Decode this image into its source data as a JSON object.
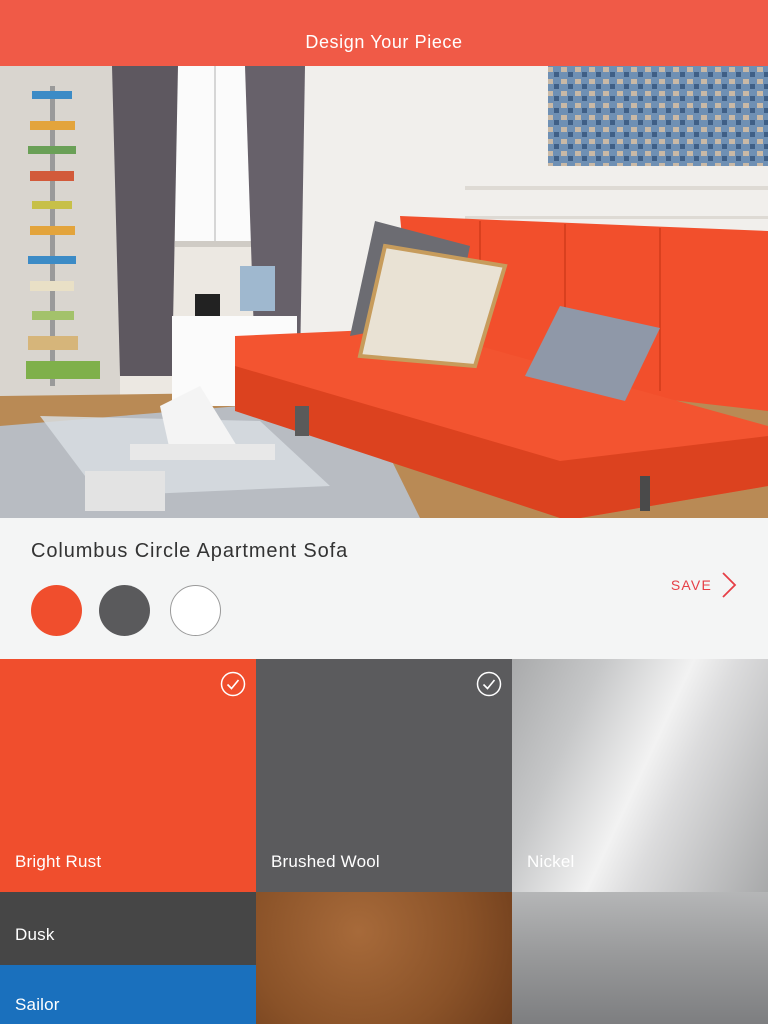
{
  "header": {
    "title": "Design Your Piece"
  },
  "product": {
    "name": "Columbus Circle Apartment Sofa",
    "swatches": [
      {
        "name": "Bright Rust",
        "color": "#f04e2d"
      },
      {
        "name": "Brushed Wool",
        "color": "#5a5a5c"
      },
      {
        "name": "White",
        "color": "#ffffff"
      }
    ],
    "save_label": "SAVE"
  },
  "materials": [
    {
      "label": "Bright Rust",
      "selected": true,
      "color": "#f04e2d"
    },
    {
      "label": "Brushed Wool",
      "selected": true,
      "color": "#5b5b5d"
    },
    {
      "label": "Nickel",
      "selected": false,
      "color": "#c6c7c8"
    },
    {
      "label": "Dusk",
      "selected": false,
      "color": "#464646"
    },
    {
      "label": "",
      "selected": false,
      "color": "#8a5228"
    },
    {
      "label": "",
      "selected": false,
      "color": "#9a9b9c"
    },
    {
      "label": "Sailor",
      "selected": false,
      "color": "#1a70bd"
    }
  ],
  "icons": {
    "check": "check-circle-icon",
    "chevron": "chevron-right-icon"
  }
}
